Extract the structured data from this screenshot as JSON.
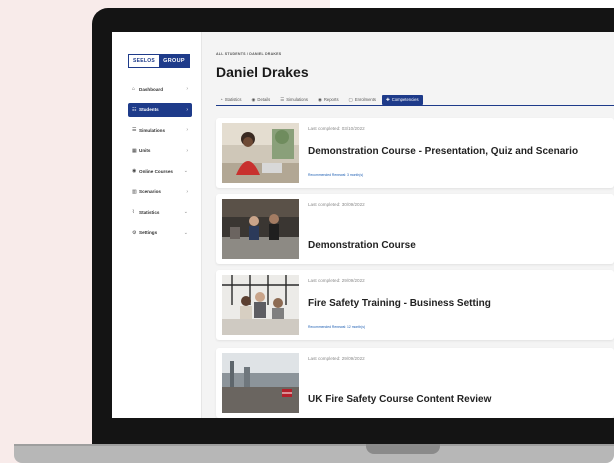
{
  "logo": {
    "left": "SEELOS",
    "right": "GROUP"
  },
  "sidebar": {
    "items": [
      {
        "label": "Dashboard",
        "icon": "home-icon",
        "glyph": "⌂",
        "chev": "›",
        "active": false
      },
      {
        "label": "Students",
        "icon": "users-icon",
        "glyph": "☷",
        "chev": "›",
        "active": true
      },
      {
        "label": "Simulations",
        "icon": "list-icon",
        "glyph": "☰",
        "chev": "›",
        "active": false
      },
      {
        "label": "Units",
        "icon": "units-icon",
        "glyph": "▦",
        "chev": "›",
        "active": false
      },
      {
        "label": "Online Courses",
        "icon": "course-icon",
        "glyph": "◉",
        "chev": "⌄",
        "active": false
      },
      {
        "label": "Scenarios",
        "icon": "scenario-icon",
        "glyph": "▥",
        "chev": "›",
        "active": false
      },
      {
        "label": "Statistics",
        "icon": "chart-icon",
        "glyph": "⌇",
        "chev": "⌄",
        "active": false
      },
      {
        "label": "Settings",
        "icon": "gear-icon",
        "glyph": "⚙",
        "chev": "⌄",
        "active": false
      }
    ]
  },
  "breadcrumb": "ALL STUDENTS  /  DANIEL DRAKES",
  "page_title": "Daniel Drakes",
  "tabs": [
    {
      "label": "Statistics",
      "glyph": "◔",
      "active": false
    },
    {
      "label": "Details",
      "glyph": "◉",
      "active": false
    },
    {
      "label": "Simulations",
      "glyph": "☰",
      "active": false
    },
    {
      "label": "Reports",
      "glyph": "◉",
      "active": false
    },
    {
      "label": "Enrolments",
      "glyph": "▢",
      "active": false
    },
    {
      "label": "Competencies",
      "glyph": "✚",
      "active": true
    }
  ],
  "courses": [
    {
      "last_completed": "Last completed: 03/10/2022",
      "title": "Demonstration Course - Presentation, Quiz and Scenario",
      "renewal": "Recommended Renewal: 3 month(s)"
    },
    {
      "last_completed": "Last completed: 30/09/2022",
      "title": "Demonstration Course",
      "renewal": ""
    },
    {
      "last_completed": "Last completed: 29/09/2022",
      "title": "Fire Safety Training - Business Setting",
      "renewal": "Recommended Renewal: 12 month(s)"
    },
    {
      "last_completed": "Last completed: 29/09/2022",
      "title": "UK Fire Safety Course Content Review",
      "renewal": ""
    }
  ],
  "colors": {
    "accent": "#1e3b8a",
    "link": "#1e5fb3",
    "bg_tint": "#f8ebea"
  }
}
